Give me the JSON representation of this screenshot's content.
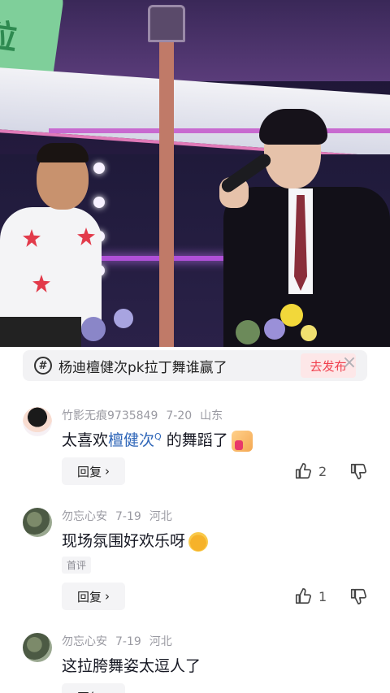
{
  "video": {
    "logo_text": "粒"
  },
  "topic": {
    "icon": "#",
    "text": "杨迪檀健次pk拉丁舞谁赢了",
    "publish_label": "去发布",
    "close_icon": "×"
  },
  "comments": [
    {
      "user": "竹影无痕9735849",
      "date": "7-20",
      "location": "山东",
      "text_before": "太喜欢",
      "mention": "檀健次",
      "mention_icon": "Q",
      "text_after": "的舞蹈了",
      "emoji": "thumbs-up-emoji",
      "reply_label": "回复",
      "likes": "2"
    },
    {
      "user": "勿忘心安",
      "date": "7-19",
      "location": "河北",
      "text": "现场氛围好欢乐呀",
      "emoji": "laughing-emoji",
      "tag": "首评",
      "reply_label": "回复",
      "likes": "1"
    },
    {
      "user": "勿忘心安",
      "date": "7-19",
      "location": "河北",
      "text": "这拉胯舞姿太逗人了",
      "reply_label": "回复"
    }
  ],
  "colors": {
    "mention": "#2f66b8",
    "publish": "#f0404e",
    "meta": "#9a9aa2"
  },
  "icons": [
    "hashtag-icon",
    "close-icon",
    "like-icon",
    "dislike-icon",
    "chevron-right-icon",
    "search-icon"
  ]
}
